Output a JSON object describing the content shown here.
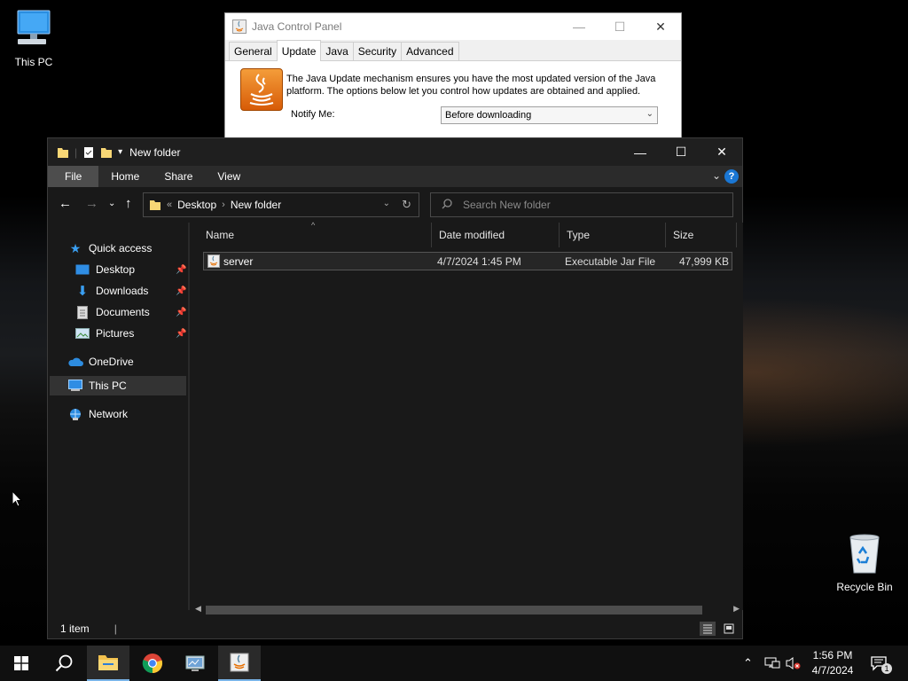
{
  "desktop": {
    "icons": [
      {
        "label": "This PC"
      },
      {
        "label": "Recycle Bin"
      }
    ]
  },
  "java_panel": {
    "title": "Java Control Panel",
    "tabs": [
      "General",
      "Update",
      "Java",
      "Security",
      "Advanced"
    ],
    "active_tab": "Update",
    "description": "The Java Update mechanism ensures you have the most updated version of the Java platform. The options below let you control how updates are obtained and applied.",
    "notify_label": "Notify Me:",
    "notify_value": "Before downloading"
  },
  "explorer": {
    "title": "New folder",
    "ribbon_tabs": [
      "File",
      "Home",
      "Share",
      "View"
    ],
    "help_label": "?",
    "address": {
      "overflow": "«",
      "crumbs": [
        "Desktop",
        "New folder"
      ]
    },
    "search_placeholder": "Search New folder",
    "nav": {
      "quick_access": "Quick access",
      "pinned": [
        "Desktop",
        "Downloads",
        "Documents",
        "Pictures"
      ],
      "onedrive": "OneDrive",
      "this_pc": "This PC",
      "network": "Network"
    },
    "columns": [
      "Name",
      "Date modified",
      "Type",
      "Size"
    ],
    "files": [
      {
        "name": "server",
        "date": "4/7/2024 1:45 PM",
        "type": "Executable Jar File",
        "size": "47,999 KB"
      }
    ],
    "status": "1 item",
    "accent": "#1a77d4"
  },
  "taskbar": {
    "time": "1:56 PM",
    "date": "4/7/2024",
    "notifications": "1"
  }
}
